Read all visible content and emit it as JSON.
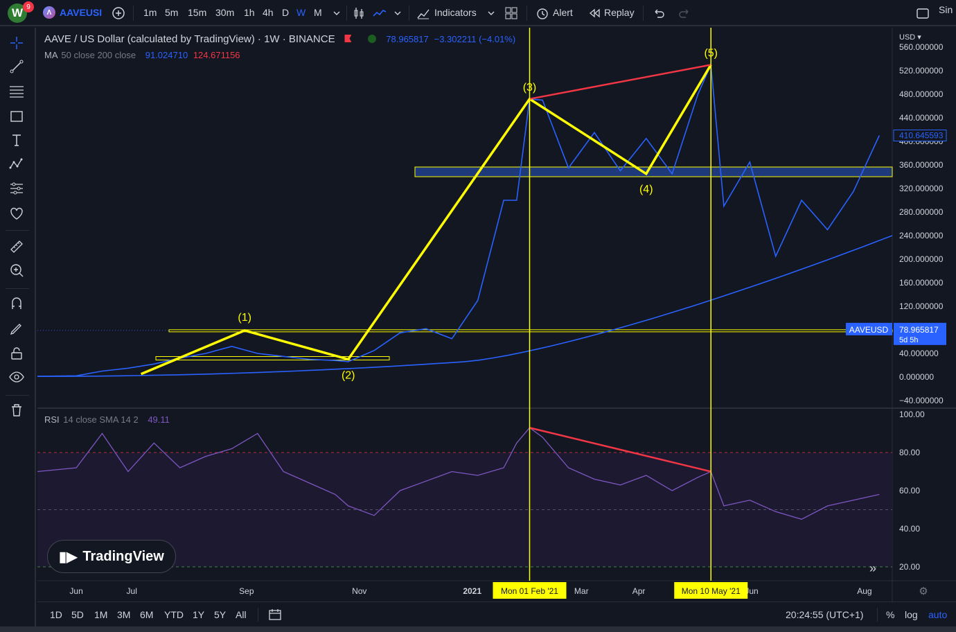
{
  "topbar": {
    "avatar_letter": "W",
    "notifications": "9",
    "symbol": "AAVEUSI",
    "intervals": [
      "1m",
      "5m",
      "15m",
      "30m",
      "1h",
      "4h",
      "D",
      "W",
      "M"
    ],
    "active_interval": "W",
    "indicators_label": "Indicators",
    "alert_label": "Alert",
    "replay_label": "Replay",
    "right_label": "Sin"
  },
  "legend": {
    "title": "AAVE / US Dollar (calculated by TradingView) · 1W · BINANCE",
    "price": "78.965817",
    "change": "−3.302211 (−4.01%)",
    "ma_label": "MA",
    "ma_params": "50 close 200 close",
    "ma50": "91.024710",
    "ma200": "124.671156",
    "rsi_label": "RSI",
    "rsi_params": "14 close SMA 14 2",
    "rsi_value": "49.11"
  },
  "price_axis": {
    "currency": "USD",
    "ticks": [
      "560.000000",
      "520.000000",
      "480.000000",
      "440.000000",
      "400.000000",
      "360.000000",
      "320.000000",
      "280.000000",
      "240.000000",
      "200.000000",
      "160.000000",
      "120.000000",
      "40.000000",
      "0.000000",
      "−40.000000"
    ],
    "marker_blue": "410.645593",
    "symbol_tag": "AAVEUSD",
    "last_price": "78.965817",
    "countdown": "5d 5h"
  },
  "rsi_axis": {
    "ticks": [
      "100.00",
      "80.00",
      "60.00",
      "40.00",
      "20.00"
    ]
  },
  "time_axis": {
    "labels": [
      "Jun",
      "Jul",
      "Sep",
      "Nov",
      "2021",
      "Mar",
      "Apr",
      "Jun",
      "Aug"
    ],
    "highlight_1": "Mon 01 Feb '21",
    "highlight_2": "Mon 10 May '21"
  },
  "waves": [
    "(1)",
    "(2)",
    "(3)",
    "(4)",
    "(5)"
  ],
  "bottombar": {
    "ranges": [
      "1D",
      "5D",
      "1M",
      "3M",
      "6M",
      "YTD",
      "1Y",
      "5Y",
      "All"
    ],
    "time": "20:24:55 (UTC+1)",
    "pct": "%",
    "log": "log",
    "auto": "auto"
  },
  "brand": "TradingView",
  "colors": {
    "background": "#131722",
    "accent": "#2962ff",
    "price_line": "#2962ff",
    "wave_line": "#ffff00",
    "divergence": "#f23645",
    "rsi_line": "#7e57c2",
    "zone_fill": "#1e3a7a"
  },
  "chart_data": {
    "type": "line",
    "price_series": {
      "name": "AAVEUSD",
      "x": [
        "2020-05-11",
        "2020-06-01",
        "2020-06-15",
        "2020-06-29",
        "2020-07-13",
        "2020-07-27",
        "2020-08-10",
        "2020-08-24",
        "2020-09-07",
        "2020-09-21",
        "2020-10-05",
        "2020-10-19",
        "2020-10-26",
        "2020-11-09",
        "2020-11-23",
        "2020-12-07",
        "2020-12-21",
        "2021-01-04",
        "2021-01-18",
        "2021-01-25",
        "2021-02-01",
        "2021-02-08",
        "2021-02-22",
        "2021-03-08",
        "2021-03-22",
        "2021-04-05",
        "2021-04-19",
        "2021-05-03",
        "2021-05-10",
        "2021-05-17",
        "2021-05-31",
        "2021-06-14",
        "2021-06-28",
        "2021-07-12",
        "2021-07-26",
        "2021-08-09"
      ],
      "y": [
        1,
        2,
        10,
        15,
        22,
        32,
        40,
        52,
        40,
        35,
        30,
        28,
        26,
        45,
        75,
        82,
        65,
        130,
        300,
        300,
        472,
        470,
        355,
        415,
        350,
        405,
        345,
        480,
        530,
        290,
        365,
        205,
        300,
        250,
        315,
        410
      ]
    },
    "ma_series": {
      "name": "MA",
      "y_note": "slow moving average rising from ~0 to ~240"
    },
    "rsi_series": {
      "name": "RSI",
      "y": [
        70,
        72,
        90,
        70,
        85,
        72,
        78,
        82,
        90,
        70,
        64,
        58,
        52,
        47,
        60,
        65,
        70,
        68,
        72,
        85,
        93,
        88,
        72,
        66,
        63,
        68,
        60,
        67,
        70,
        52,
        55,
        49,
        45,
        52,
        55,
        58
      ]
    },
    "zones": [
      {
        "label": "resistance zone",
        "low": 340,
        "high": 360
      },
      {
        "label": "wave 1 high",
        "value": 79
      },
      {
        "label": "wave 2 low",
        "value": 30
      }
    ],
    "ylim": [
      -40,
      560
    ]
  }
}
